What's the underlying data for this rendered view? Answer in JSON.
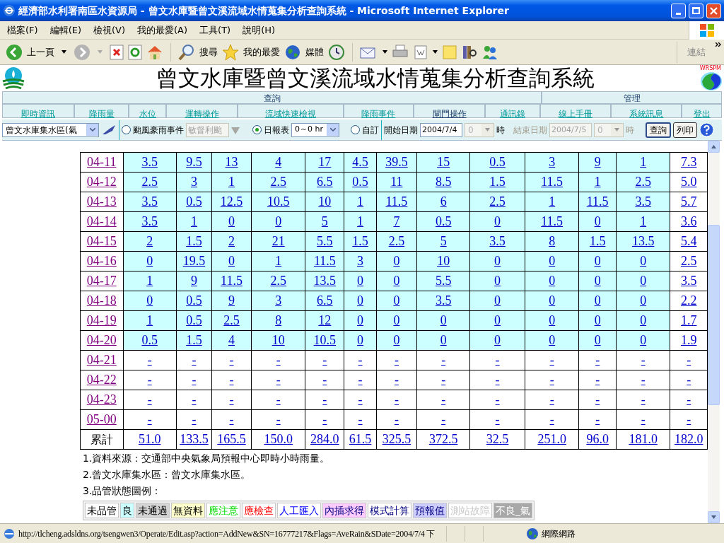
{
  "window": {
    "title": "經濟部水利署南區水資源局 - 曾文水庫暨曾文溪流域水情蒐集分析查詢系統 - Microsoft Internet Explorer"
  },
  "menu": [
    "檔案(F)",
    "編輯(E)",
    "檢視(V)",
    "我的最愛(A)",
    "工具(T)",
    "說明(H)"
  ],
  "toolbar": {
    "back": "上一頁",
    "search": "搜尋",
    "favorites": "我的最愛",
    "media": "媒體",
    "links": "連結"
  },
  "header": {
    "title": "曾文水庫暨曾文溪流域水情蒐集分析查詢系統",
    "logo_text": "WRSPM"
  },
  "nav": {
    "groups": [
      "查詢",
      "管理"
    ],
    "links": [
      {
        "label": "即時資訊",
        "selected": false
      },
      {
        "label": "降雨量",
        "selected": false
      },
      {
        "label": "水位",
        "selected": false
      },
      {
        "label": "運轉操作",
        "selected": false
      },
      {
        "label": "流域快速檢視",
        "selected": false
      },
      {
        "label": "降雨事件",
        "selected": false
      },
      {
        "label": "閘門操作",
        "selected": true
      },
      {
        "label": "通訊錄",
        "selected": false
      },
      {
        "label": "線上手冊",
        "selected": false
      },
      {
        "label": "系統訊息",
        "selected": false
      },
      {
        "label": "登出",
        "selected": false
      }
    ]
  },
  "controls": {
    "area": "曾文水庫集水區(氣",
    "modes": [
      {
        "label": "颱風豪雨事件",
        "selected": false
      },
      {
        "label": "日報表",
        "selected": true
      },
      {
        "label": "自訂",
        "selected": false
      }
    ],
    "event": "敏督利颱",
    "report_range": "0～0 hr",
    "start_label": "開始日期",
    "start_date": "2004/7/4",
    "start_hour": "0",
    "hour_unit": "時",
    "end_label": "結束日期",
    "end_date": "2004/7/5",
    "end_hour": "0",
    "end_hour_unit": "時",
    "buttons": [
      "查詢",
      "列印"
    ]
  },
  "table": {
    "rows": [
      {
        "kind": "data",
        "date": "04-11",
        "values": [
          "3.5",
          "9.5",
          "13",
          "4",
          "17",
          "4.5",
          "39.5",
          "15",
          "0.5",
          "3",
          "9",
          "1",
          "7.3"
        ]
      },
      {
        "kind": "data",
        "date": "04-12",
        "values": [
          "2.5",
          "3",
          "1",
          "2.5",
          "6.5",
          "0.5",
          "11",
          "8.5",
          "1.5",
          "11.5",
          "1",
          "2.5",
          "5.0"
        ]
      },
      {
        "kind": "data",
        "date": "04-13",
        "values": [
          "3.5",
          "0.5",
          "12.5",
          "10.5",
          "10",
          "1",
          "11.5",
          "6",
          "2.5",
          "1",
          "11.5",
          "3.5",
          "5.7"
        ]
      },
      {
        "kind": "data",
        "date": "04-14",
        "values": [
          "3.5",
          "1",
          "0",
          "0",
          "5",
          "1",
          "7",
          "0.5",
          "0",
          "11.5",
          "0",
          "1",
          "3.6"
        ]
      },
      {
        "kind": "data",
        "date": "04-15",
        "values": [
          "2",
          "1.5",
          "2",
          "21",
          "5.5",
          "1.5",
          "2.5",
          "5",
          "3.5",
          "8",
          "1.5",
          "13.5",
          "5.4"
        ]
      },
      {
        "kind": "data",
        "date": "04-16",
        "values": [
          "0",
          "19.5",
          "0",
          "1",
          "11.5",
          "3",
          "0",
          "10",
          "0",
          "0",
          "0",
          "0",
          "2.5"
        ]
      },
      {
        "kind": "data",
        "date": "04-17",
        "values": [
          "1",
          "9",
          "11.5",
          "2.5",
          "13.5",
          "0",
          "0",
          "5.5",
          "0",
          "0",
          "0",
          "0",
          "3.5"
        ]
      },
      {
        "kind": "data",
        "date": "04-18",
        "values": [
          "0",
          "0.5",
          "9",
          "3",
          "6.5",
          "0",
          "0",
          "3.5",
          "0",
          "0",
          "0",
          "0",
          "2.2"
        ]
      },
      {
        "kind": "data",
        "date": "04-19",
        "values": [
          "1",
          "0.5",
          "2.5",
          "8",
          "12",
          "0",
          "0",
          "0",
          "0",
          "0",
          "0",
          "0",
          "1.7"
        ]
      },
      {
        "kind": "data",
        "date": "04-20",
        "values": [
          "0.5",
          "1.5",
          "4",
          "10",
          "10.5",
          "0",
          "0",
          "0",
          "0",
          "0",
          "0",
          "0",
          "1.9"
        ]
      },
      {
        "kind": "empty",
        "date": "04-21",
        "values": [
          "-",
          "-",
          "-",
          "-",
          "-",
          "-",
          "-",
          "-",
          "-",
          "-",
          "-",
          "-",
          "-"
        ]
      },
      {
        "kind": "empty",
        "date": "04-22",
        "values": [
          "-",
          "-",
          "-",
          "-",
          "-",
          "-",
          "-",
          "-",
          "-",
          "-",
          "-",
          "-",
          "-"
        ]
      },
      {
        "kind": "empty",
        "date": "04-23",
        "values": [
          "-",
          "-",
          "-",
          "-",
          "-",
          "-",
          "-",
          "-",
          "-",
          "-",
          "-",
          "-",
          "-"
        ]
      },
      {
        "kind": "empty",
        "date": "05-00",
        "values": [
          "-",
          "-",
          "-",
          "-",
          "-",
          "-",
          "-",
          "-",
          "-",
          "-",
          "-",
          "-",
          "-"
        ]
      },
      {
        "kind": "total",
        "date": "累計",
        "values": [
          "51.0",
          "133.5",
          "165.5",
          "150.0",
          "284.0",
          "61.5",
          "325.5",
          "372.5",
          "32.5",
          "251.0",
          "96.0",
          "181.0",
          "182.0"
        ]
      }
    ]
  },
  "notes": [
    "1.資料來源：交通部中央氣象局預報中心即時小時雨量。",
    "2.曾文水庫集水區：曾文水庫集水區。",
    "3.品管狀態圖例："
  ],
  "legend": [
    {
      "label": "未品管",
      "kind": "unchecked",
      "color": "#ffffff"
    },
    {
      "label": "良",
      "kind": "good",
      "color": "#ccffff"
    },
    {
      "label": "未通過",
      "kind": "failed",
      "color": "#d4d4d4"
    },
    {
      "label": "無資料",
      "kind": "nodata",
      "color": "#ffffcc"
    },
    {
      "label": "應注意",
      "kind": "warning",
      "color": "#ffffff"
    },
    {
      "label": "應檢查",
      "kind": "check",
      "color": "#ffffff"
    },
    {
      "label": "人工匯入",
      "kind": "manual",
      "color": "#ffffff"
    },
    {
      "label": "內插求得",
      "kind": "interpolated",
      "color": "#ffccff"
    },
    {
      "label": "模式計算",
      "kind": "model",
      "color": "#ffffff"
    },
    {
      "label": "預報值",
      "kind": "forecast",
      "color": "#ccccff"
    },
    {
      "label": "測站故障",
      "kind": "fault",
      "color": "#ffffff"
    },
    {
      "label": "不良_氣",
      "kind": "bad",
      "color": "#a8a8a8"
    }
  ],
  "status_bar": {
    "url": "http://tlcheng.adsldns.org/tsengwen3/Operate/Edit.asp?action=AddNew&SN=16777217&Flags=AveRain&SDate=2004/7/4 下",
    "zone": "網際網路"
  }
}
